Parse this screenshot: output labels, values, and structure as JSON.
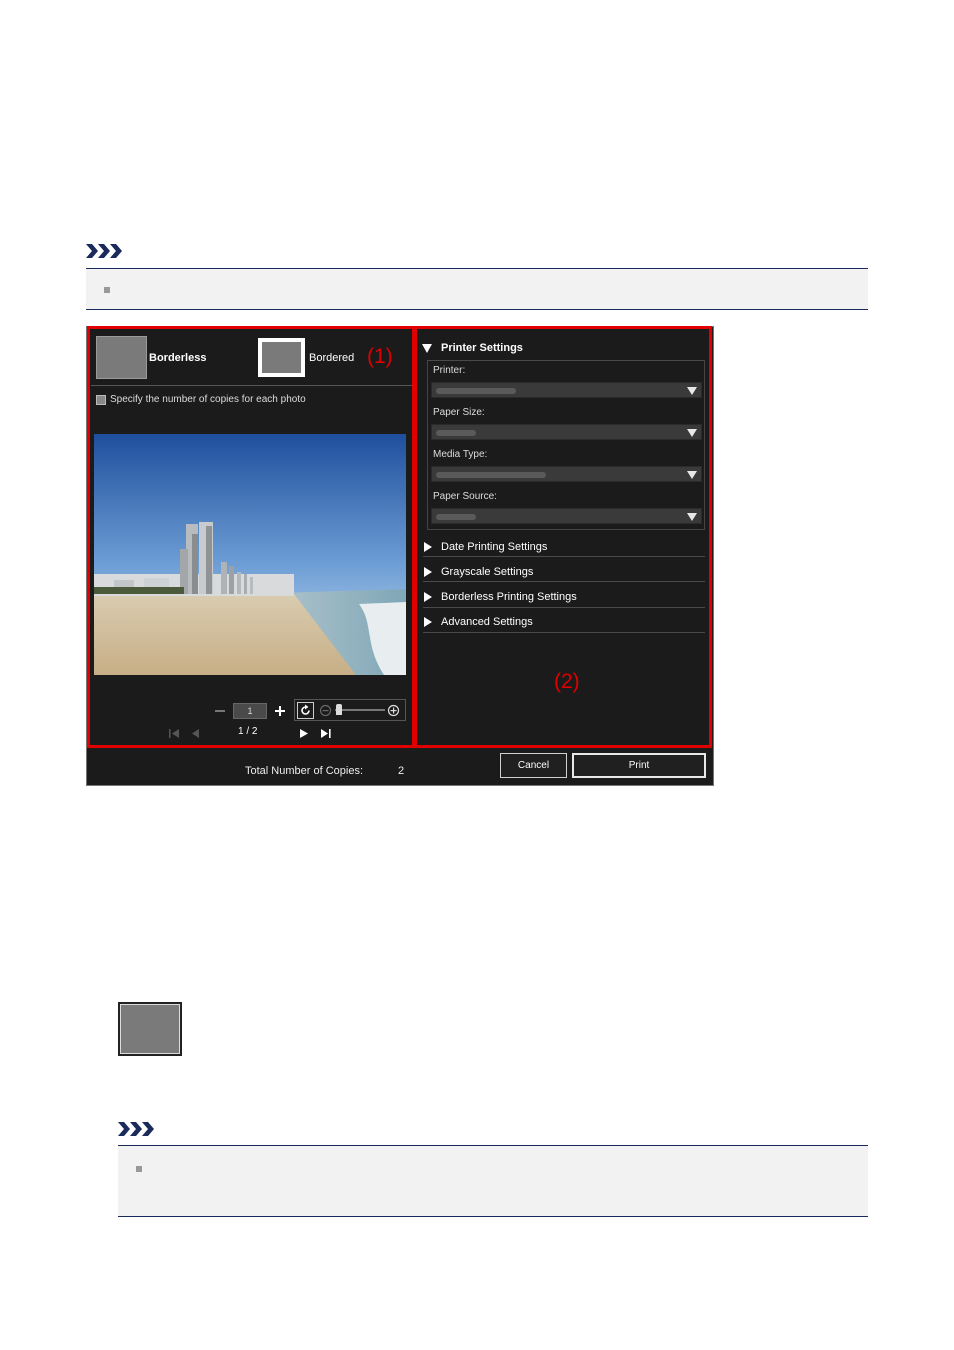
{
  "note_top": {
    "icon": "note-chevrons-icon"
  },
  "dialog": {
    "layout_options": [
      {
        "label": "Borderless"
      },
      {
        "label": "Bordered"
      }
    ],
    "region_labels": {
      "left": "(1)",
      "right": "(2)"
    },
    "copies_checkbox_label": "Specify the number of copies for each photo",
    "copies_value": "1",
    "page_indicator": "1 / 2",
    "printer_settings": {
      "title": "Printer Settings",
      "fields": [
        {
          "label": "Printer:"
        },
        {
          "label": "Paper Size:"
        },
        {
          "label": "Media Type:"
        },
        {
          "label": "Paper Source:"
        }
      ]
    },
    "sections": [
      {
        "label": "Date Printing Settings"
      },
      {
        "label": "Grayscale Settings"
      },
      {
        "label": "Borderless Printing Settings"
      },
      {
        "label": "Advanced Settings"
      }
    ],
    "footer": {
      "total_label": "Total Number of Copies:",
      "total_value": "2",
      "cancel": "Cancel",
      "print": "Print"
    }
  },
  "note_bottom": {
    "icon": "note-chevrons-icon"
  }
}
